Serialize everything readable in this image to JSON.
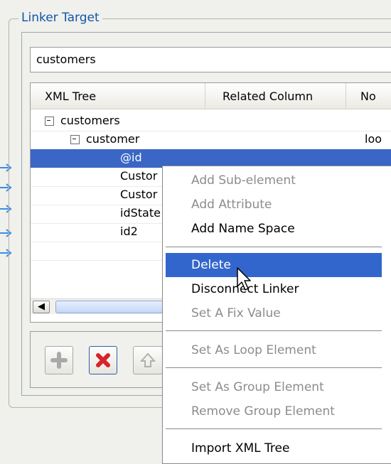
{
  "group": {
    "title": "Linker Target"
  },
  "combo": {
    "value": "customers"
  },
  "table": {
    "headers": [
      "XML Tree",
      "Related Column",
      "No"
    ],
    "rows": [
      {
        "name": "customers",
        "related": "",
        "node": ""
      },
      {
        "name": "customer",
        "related": "",
        "node": "loo"
      },
      {
        "name": "@id",
        "related": "",
        "node": ""
      },
      {
        "name": "Custor",
        "related": "",
        "node": ""
      },
      {
        "name": "Custor",
        "related": "",
        "node": ""
      },
      {
        "name": "idState",
        "related": "",
        "node": ""
      },
      {
        "name": "id2",
        "related": "",
        "node": ""
      }
    ]
  },
  "icons": {
    "link_arrow": "arrow-right-icon",
    "add": "plus-icon",
    "delete": "red-x-icon",
    "move_up": "up-arrow-icon",
    "scroll_left": "chevron-left-icon",
    "cursor": "mouse-pointer-icon"
  },
  "colors": {
    "selection": "#3a66c6",
    "menu_hover": "#3366cc",
    "group_title": "#0e57a8",
    "delete_icon": "#d8232a"
  },
  "context_menu": {
    "items": [
      {
        "label": "Add Sub-element",
        "enabled": false
      },
      {
        "label": "Add Attribute",
        "enabled": false
      },
      {
        "label": "Add Name Space",
        "enabled": true
      },
      {
        "label": "Delete",
        "enabled": true,
        "highlighted": true
      },
      {
        "label": "Disconnect Linker",
        "enabled": true
      },
      {
        "label": "Set A Fix Value",
        "enabled": false
      },
      {
        "label": "Set As Loop Element",
        "enabled": false
      },
      {
        "label": "Set As Group Element",
        "enabled": false
      },
      {
        "label": "Remove Group Element",
        "enabled": false
      },
      {
        "label": "Import XML Tree",
        "enabled": true
      }
    ]
  }
}
